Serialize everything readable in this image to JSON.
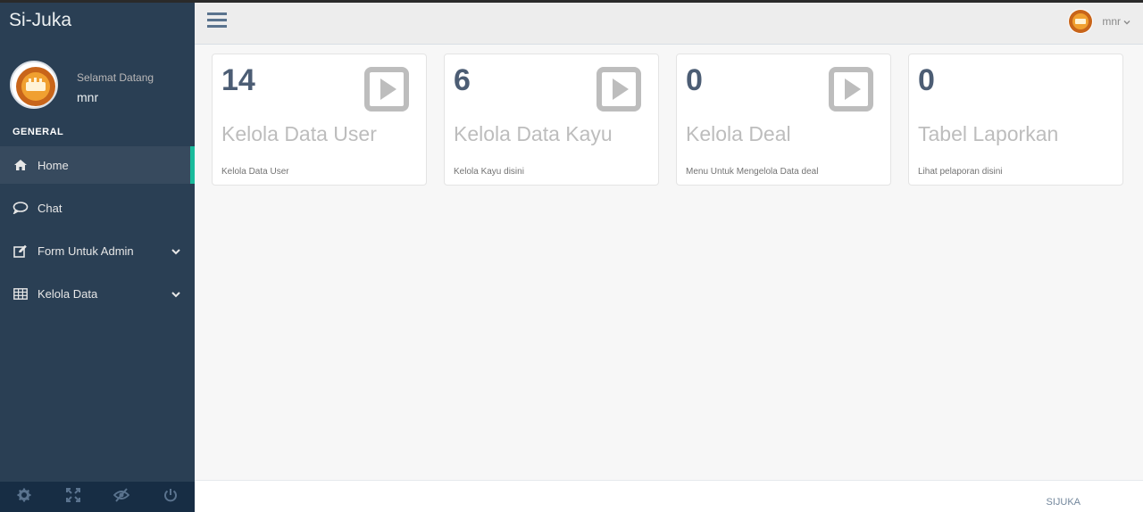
{
  "app": {
    "brand": "Si-Juka"
  },
  "profile": {
    "welcome": "Selamat Datang",
    "name": "mnr"
  },
  "sidebar": {
    "section_title": "GENERAL",
    "items": [
      {
        "label": "Home",
        "icon": "home-icon",
        "active": true
      },
      {
        "label": "Chat",
        "icon": "chat-icon"
      },
      {
        "label": "Form Untuk Admin",
        "icon": "edit-icon",
        "has_submenu": true
      },
      {
        "label": "Kelola Data",
        "icon": "table-icon",
        "has_submenu": true
      }
    ],
    "footer_icons": [
      "settings-icon",
      "fullscreen-icon",
      "eye-slash-icon",
      "power-icon"
    ]
  },
  "topnav": {
    "user_name": "mnr"
  },
  "tiles": [
    {
      "count": "14",
      "title": "Kelola Data User",
      "desc": "Kelola Data User"
    },
    {
      "count": "6",
      "title": "Kelola Data Kayu",
      "desc": "Kelola Kayu disini"
    },
    {
      "count": "0",
      "title": "Kelola Deal",
      "desc": "Menu Untuk Mengelola Data deal"
    },
    {
      "count": "0",
      "title": "Tabel Laporkan",
      "desc": "Lihat pelaporan disini"
    }
  ],
  "footer": {
    "text": "SIJUKA"
  },
  "colors": {
    "sidebar": "#2a3f54",
    "accent": "#1abb9c",
    "count": "#4c5d74",
    "tile_icon": "#bdbdbd"
  }
}
